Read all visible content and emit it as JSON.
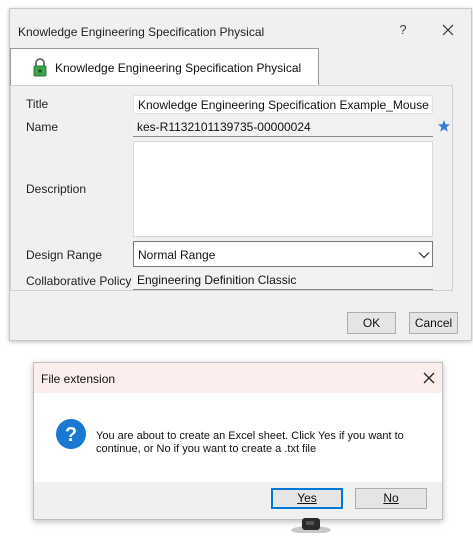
{
  "main_dialog": {
    "title": "Knowledge Engineering Specification Physical",
    "help_label": "?",
    "tab_label": "Knowledge Engineering Specification Physical",
    "fields": {
      "title_label": "Title",
      "title_value": "Knowledge Engineering Specification Example_Mouse",
      "name_label": "Name",
      "name_value": "kes-R1132101139735-00000024",
      "description_label": "Description",
      "description_value": "",
      "design_range_label": "Design Range",
      "design_range_value": "Normal Range",
      "collab_policy_label": "Collaborative Policy",
      "collab_policy_value": "Engineering Definition Classic"
    },
    "buttons": {
      "ok": "OK",
      "cancel": "Cancel"
    }
  },
  "message_box": {
    "title": "File extension",
    "text": "You are about to create an Excel sheet. Click Yes if you want to continue, or No if you want to create a .txt file",
    "buttons": {
      "yes": "Yes",
      "no": "No"
    }
  },
  "colors": {
    "dialog_bg": "#f0f0f0",
    "message_titlebar": "#fbeeed",
    "question_icon": "#1a78d2",
    "star_icon": "#3a7bd5",
    "default_button_border": "#0078d7"
  },
  "icons": [
    "close-icon",
    "padlock-icon",
    "star-icon",
    "chevron-down-icon",
    "question-icon"
  ]
}
